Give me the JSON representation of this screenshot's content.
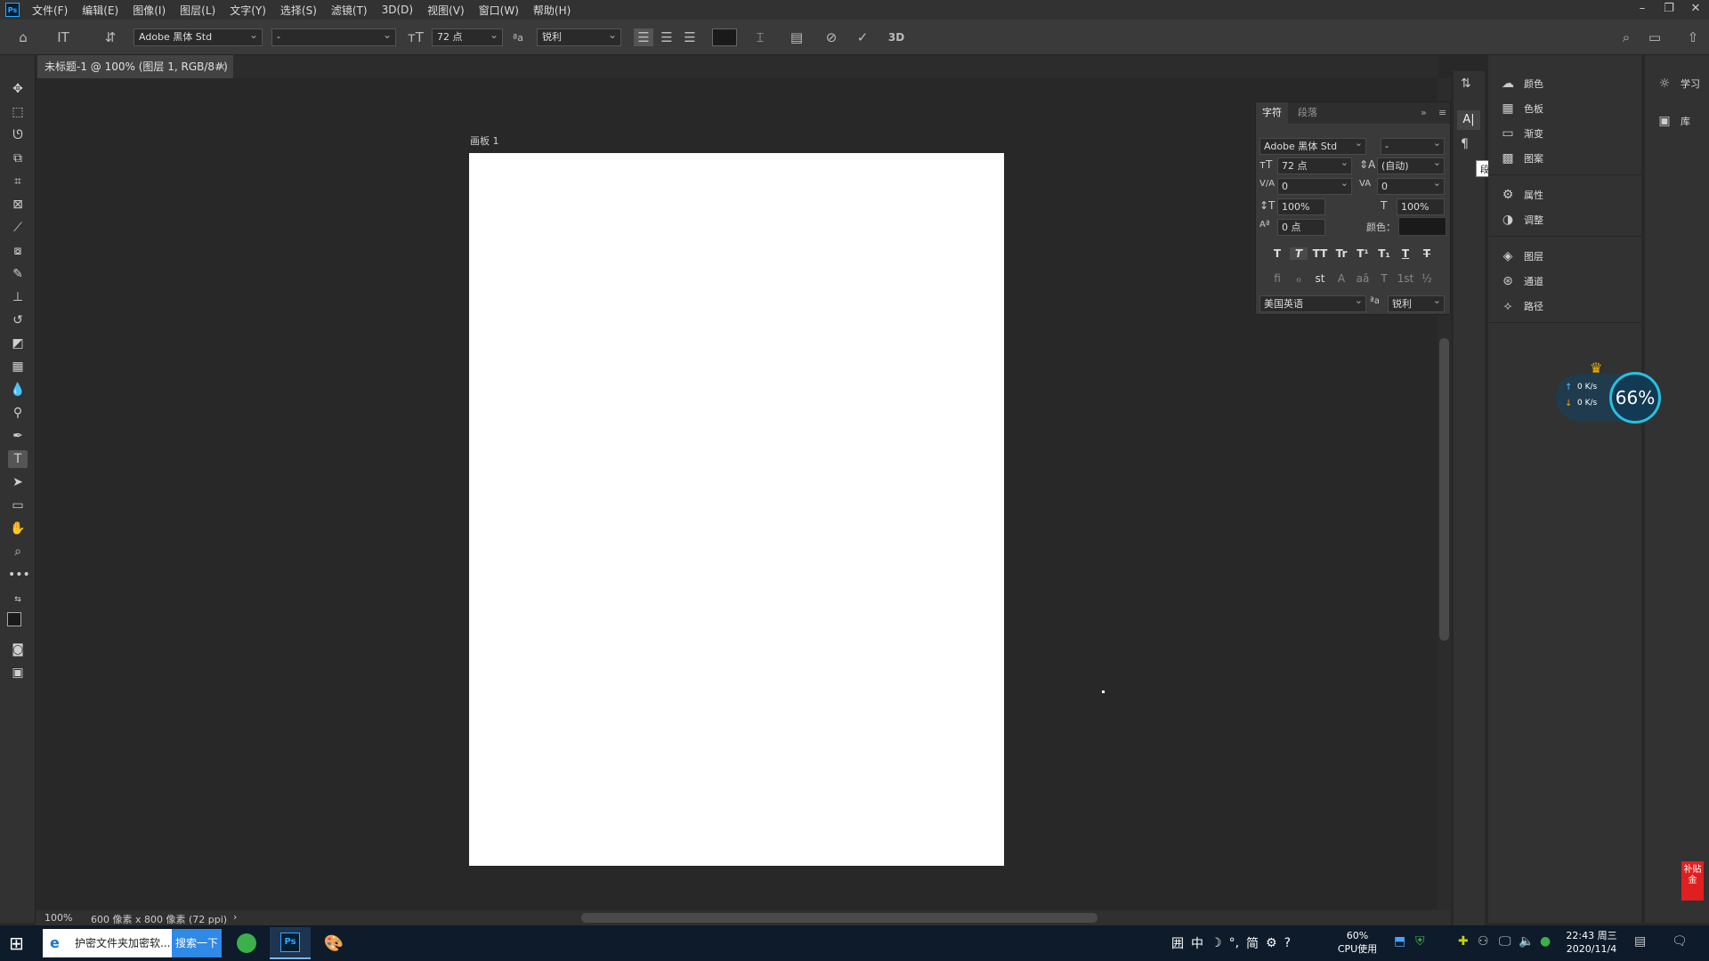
{
  "menubar": {
    "app_icon": "Ps",
    "items": [
      "文件(F)",
      "编辑(E)",
      "图像(I)",
      "图层(L)",
      "文字(Y)",
      "选择(S)",
      "滤镜(T)",
      "3D(D)",
      "视图(V)",
      "窗口(W)",
      "帮助(H)"
    ]
  },
  "options": {
    "font_family": "Adobe 黑体 Std",
    "font_style": "-",
    "font_size": "72 点",
    "antialias_icon": "ªa",
    "antialias": "锐利",
    "btn_3d": "3D"
  },
  "document": {
    "tab_title": "未标题-1 @ 100% (图层 1, RGB/8#)",
    "tab_close": "×",
    "artboard_label": "画板 1"
  },
  "status": {
    "zoom": "100%",
    "dimensions": "600 像素 x 800 像素 (72 ppi)"
  },
  "character_panel": {
    "tab_character": "字符",
    "tab_paragraph": "段落",
    "font_family": "Adobe 黑体 Std",
    "font_style": "-",
    "size": "72 点",
    "leading": "(自动)",
    "kerning": "0",
    "tracking": "0",
    "vscale": "100%",
    "hscale": "100%",
    "baseline": "0 点",
    "color_label": "颜色：",
    "language": "美国英语",
    "antialias": "锐利",
    "style_buttons": [
      "T",
      "T",
      "TT",
      "Tr",
      "T¹",
      "T₁",
      "T",
      "T"
    ],
    "opentype_buttons": [
      "fi",
      "ℴ",
      "st",
      "A",
      "aā",
      "T",
      "1st",
      "½"
    ]
  },
  "tooltip": "段落",
  "dock": {
    "items": [
      "颜色",
      "色板",
      "渐变",
      "图案",
      "属性",
      "调整",
      "图层",
      "通道",
      "路径"
    ]
  },
  "dock2": {
    "items": [
      "学习",
      "库"
    ]
  },
  "net_widget": {
    "up": "0 K/s",
    "down": "0 K/s",
    "percent": "66%"
  },
  "red_tag": "补贴金",
  "taskbar": {
    "search_text": "护密文件夹加密软...",
    "search_button": "搜索一下",
    "cpu_percent": "60%",
    "cpu_label": "CPU使用",
    "time": "22:43 周三",
    "date": "2020/11/4",
    "ime": [
      "囲",
      "中",
      "☽",
      "°,",
      "简",
      "⚙",
      "?"
    ]
  },
  "colors": {
    "accent": "#31a8ff",
    "foreground": "#1a1a1a",
    "background": "#2a9bb0"
  }
}
